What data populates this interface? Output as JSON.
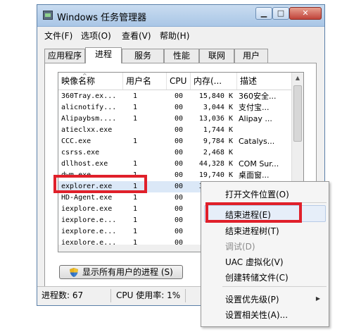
{
  "window": {
    "title": "Windows 任务管理器"
  },
  "menubar": [
    "文件(F)",
    "选项(O)",
    "查看(V)",
    "帮助(H)"
  ],
  "tabs": [
    "应用程序",
    "进程",
    "服务",
    "性能",
    "联网",
    "用户"
  ],
  "columns": [
    "映像名称",
    "用户名",
    "CPU",
    "内存(...",
    "描述"
  ],
  "rows": [
    {
      "name": "360Tray.ex...",
      "user": "1",
      "cpu": "00",
      "mem": "15,840 K",
      "desc": "360安全..."
    },
    {
      "name": "alicnotify...",
      "user": "1",
      "cpu": "00",
      "mem": "3,044 K",
      "desc": "支付宝..."
    },
    {
      "name": "Alipaybsm....",
      "user": "1",
      "cpu": "00",
      "mem": "13,036 K",
      "desc": "Alipay ..."
    },
    {
      "name": "atieclxx.exe",
      "user": "",
      "cpu": "00",
      "mem": "1,744 K",
      "desc": ""
    },
    {
      "name": "CCC.exe",
      "user": "1",
      "cpu": "00",
      "mem": "9,784 K",
      "desc": "Catalys..."
    },
    {
      "name": "csrss.exe",
      "user": "",
      "cpu": "00",
      "mem": "2,468 K",
      "desc": ""
    },
    {
      "name": "dllhost.exe",
      "user": "1",
      "cpu": "00",
      "mem": "44,328 K",
      "desc": "COM Sur..."
    },
    {
      "name": "dwm.exe",
      "user": "1",
      "cpu": "00",
      "mem": "19,740 K",
      "desc": "桌面窗..."
    },
    {
      "name": "explorer.exe",
      "user": "1",
      "cpu": "00",
      "mem": "31,... K",
      "desc": ""
    },
    {
      "name": "HD-Agent.exe",
      "user": "1",
      "cpu": "00",
      "mem": "",
      "desc": ""
    },
    {
      "name": "iexplore.exe",
      "user": "1",
      "cpu": "00",
      "mem": "",
      "desc": ""
    },
    {
      "name": "iexplore.e...",
      "user": "1",
      "cpu": "00",
      "mem": "",
      "desc": ""
    },
    {
      "name": "iexplore.e...",
      "user": "1",
      "cpu": "00",
      "mem": "",
      "desc": ""
    },
    {
      "name": "iexplore.e...",
      "user": "1",
      "cpu": "00",
      "mem": "",
      "desc": ""
    }
  ],
  "show_all_button": "显示所有用户的进程 (S)",
  "status": {
    "processes": "进程数: 67",
    "cpu": "CPU 使用率: 1%"
  },
  "context_menu": [
    "打开文件位置(O)",
    "结束进程(E)",
    "结束进程树(T)",
    "调试(D)",
    "UAC 虚拟化(V)",
    "创建转储文件(C)",
    "设置优先级(P)",
    "设置相关性(A)..."
  ],
  "colors": {
    "highlight_red": "#e0202a",
    "titlebar": "#b8d1ec",
    "selection": "#dbe8f7"
  }
}
